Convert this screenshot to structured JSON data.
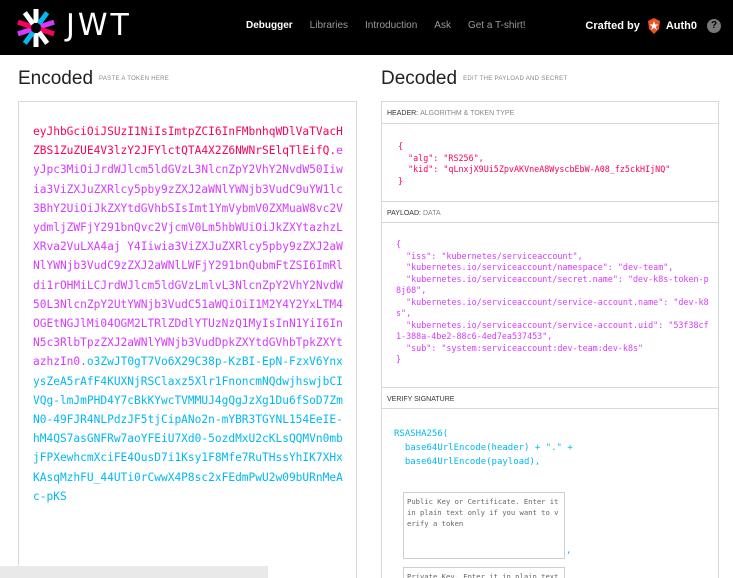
{
  "navbar": {
    "logo_text": "JWT",
    "links": [
      "Debugger",
      "Libraries",
      "Introduction",
      "Ask",
      "Get a T-shirt!"
    ],
    "active_link": "Debugger",
    "crafted_by": "Crafted by",
    "auth0_label": "Auth0",
    "help_glyph": "?"
  },
  "encoded": {
    "title": "Encoded",
    "subtitle": "PASTE A TOKEN HERE",
    "token_header": "eyJhbGciOiJSUzI1NiIsImtpZCI6InFMbnhqWDlVaTVacHZBS1ZuZUE4V3lzY2JFYlctQTA4X2Z6NWNrSElqTlEifQ",
    "dot": ".",
    "token_payload": "eyJpc3MiOiJrdWJlcm5ldGVzL3NlcnZpY2VhY2NvdW50Iiwia3ViZXJuZXRlcy5pby9zZXJ2aWNlYWNjb3VudC9uYW1lc3BhY2UiOiJkZXYtdGVhbSIsImt1YmVybmV0ZXMuaW8vc2VydmljZWFjY291bnQvc2VjcmV0Lm5hbWUiOiJkZXYtazhzLXRva2VuLXA4aj Y4Iiwia3ViZXJuZXRlcy5pby9zZXJ2aWNlYWNjb3VudC9zZXJ2aWNlLWFjY291bnQubmFtZSI6ImRldi1rOHMiLCJrdWJlcm5ldGVzLmlvL3NlcnZpY2VhY2NvdW50L3NlcnZpY2UtYWNjb3VudC51aWQiOiI1M2Y4Y2YxLTM4OGEtNGJlMi04OGM2LTRlZDdlYTUzNzQ1MyIsInN1YiI6InN5c3RlbTpzZXJ2aWNlYWNjb3VudDpkZXYtdGVhbTpkZXYtazhzIn0",
    "token_signature": "o3ZwJT0gT7Vo6X29C38p-KzBI-EpN-FzxV6YnxysZeA5rAfF4KUXNjRSClaxz5Xlr1FnoncmNQdwjhswjbCIVQg-lmJmPHD4Y7cBkKYwcTVMMUJ4gQgJzXg1Du6fSoD7ZmN0-49FJR4NLPdzJF5tjCipANo2n-mYBR3TGYNL154EeIE-hM4QS7asGNFRw7aoYFEiU7Xd0-5ozdMxU2cKLsQQMVn0mbjFPXewhcmXciFE4OusD7i1Ksy1F8Mfe7RuTHssYhIK7XHxKAsqMzhFU_44UTi0rCwwX4P8sc2xFEdmPwU2w09bURnMeAc-pKS"
  },
  "decoded": {
    "title": "Decoded",
    "subtitle": "EDIT THE PAYLOAD AND SECRET",
    "header_label": "HEADER:",
    "header_sub": "ALGORITHM & TOKEN TYPE",
    "header_json": [
      "{",
      "  \"alg\": \"RS256\",",
      "  \"kid\": \"qLnxjX9Ui5ZpvAKVneA8WyscbEbW-A08_fz5ckHIjNQ\"",
      "}"
    ],
    "payload_label": "PAYLOAD:",
    "payload_sub": "DATA",
    "payload_json": [
      "{",
      "  \"iss\": \"kubernetes/serviceaccount\",",
      "  \"kubernetes.io/serviceaccount/namespace\": \"dev-team\",",
      "  \"kubernetes.io/serviceaccount/secret.name\": \"dev-k8s-token-p8j68\",",
      "  \"kubernetes.io/serviceaccount/service-account.name\": \"dev-k8s\",",
      "  \"kubernetes.io/serviceaccount/service-account.uid\": \"53f38cf1-388a-4be2-88c6-4ed7ea537453\",",
      "  \"sub\": \"system:serviceaccount:dev-team:dev-k8s\"",
      "}"
    ],
    "verify_label": "VERIFY SIGNATURE",
    "sig_lines": [
      "RSASHA256(",
      "  base64UrlEncode(header) + \".\" +",
      "  base64UrlEncode(payload),"
    ],
    "public_key_placeholder": "Public Key or Certificate. Enter it in plain text only if you want to verify a token",
    "private_key_placeholder": "Private Key. Enter it in plain text only if you want to generate a new token",
    "comma": ","
  },
  "colors": {
    "header": "#fb015b",
    "payload": "#d63aff",
    "signature": "#00b9f1"
  }
}
